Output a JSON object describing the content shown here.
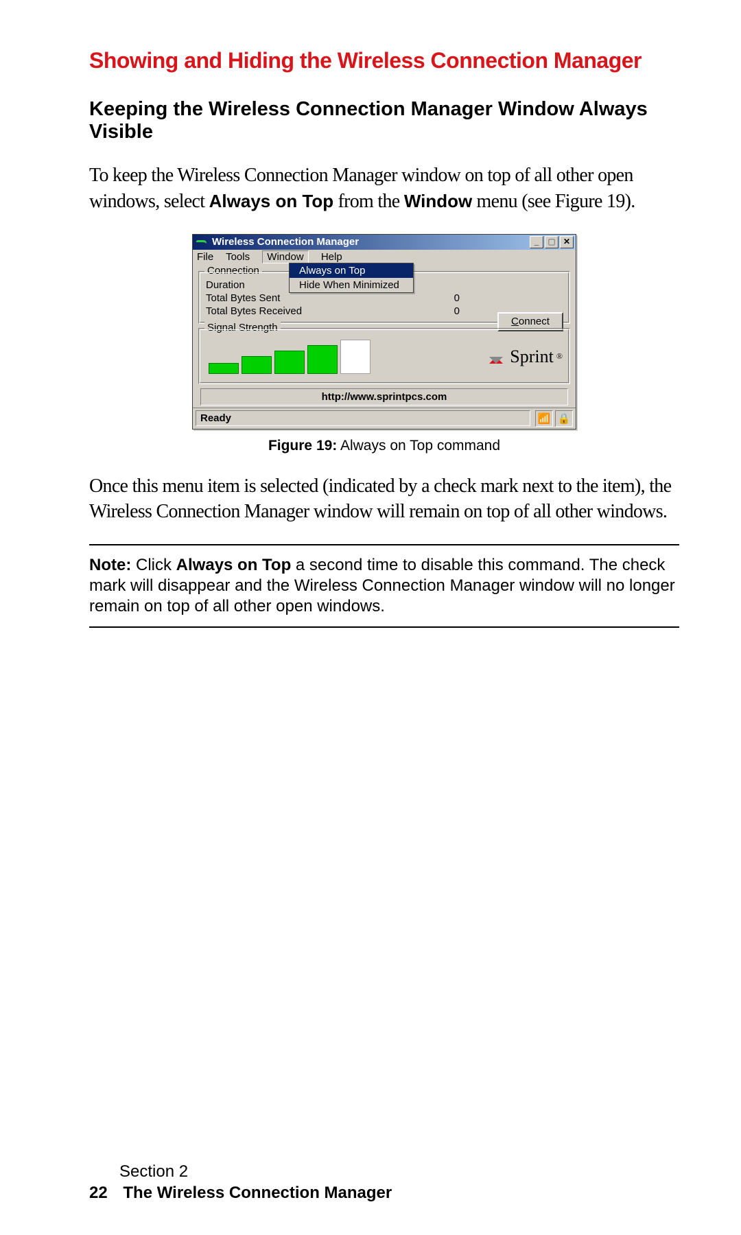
{
  "heading": "Showing and Hiding the Wireless Connection Manager",
  "subheading": "Keeping the Wireless Connection Manager Window Always Visible",
  "para1_a": "To keep the Wireless Connection Manager window on top of all other open windows, select ",
  "para1_b": "Always on Top",
  "para1_c": " from the ",
  "para1_d": "Window",
  "para1_e": " menu (see Figure 19).",
  "figure": {
    "label": "Figure 19:",
    "caption": " Always on Top command"
  },
  "para2": "Once this menu item is selected (indicated by a check mark next to the item), the Wireless Connection Manager window will remain on top of all other windows.",
  "note_a": "Note:",
  "note_b": " Click ",
  "note_c": "Always on Top",
  "note_d": " a second time to disable this command. The check mark will disappear and the Wireless Connection Manager window will no longer remain on top of all other open windows.",
  "footer": {
    "section": "Section 2",
    "page": "22",
    "chapter": "The Wireless Connection Manager"
  },
  "win": {
    "title": "Wireless Connection Manager",
    "menus": {
      "file": "File",
      "tools": "Tools",
      "window": "Window",
      "help": "Help"
    },
    "dropdown": {
      "always": "Always on Top",
      "hide": "Hide When Minimized"
    },
    "group_conn": "Connection",
    "rows": {
      "duration": "Duration",
      "sent_label": "Total Bytes Sent",
      "sent_val": "0",
      "recv_label": "Total Bytes Received",
      "recv_val": "0"
    },
    "connect_u": "C",
    "connect_rest": "onnect",
    "group_signal": "Signal Strength",
    "sprint": "Sprint",
    "url": "http://www.sprintpcs.com",
    "status": "Ready"
  }
}
